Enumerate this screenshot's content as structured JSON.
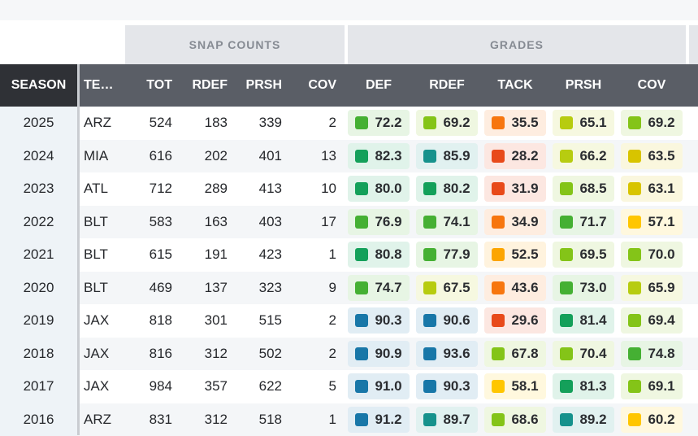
{
  "column_groups": {
    "snap_counts": "SNAP COUNTS",
    "grades": "GRADES"
  },
  "columns": {
    "season": "SEASON",
    "team": "TE…",
    "tot": "TOT",
    "rdef": "RDEF",
    "prsh": "PRSH",
    "cov": "COV",
    "g_def": "DEF",
    "g_rdef": "RDEF",
    "g_tack": "TACK",
    "g_prsh": "PRSH",
    "g_cov": "COV"
  },
  "grade_colors": {
    "elite": "#1877a8",
    "great": "#16928c",
    "high": "#14a05a",
    "good": "#45b033",
    "above_avg": "#84c418",
    "average": "#b7cc10",
    "below_avg": "#d8c400",
    "low": "#ffc600",
    "poor": "#fca500",
    "bad": "#f7760f",
    "very_bad": "#e84a1a"
  },
  "rows": [
    {
      "season": "2025",
      "team": "ARZ",
      "tot": "524",
      "rdef": "183",
      "prsh": "339",
      "cov": "2",
      "grades": [
        {
          "value": "72.2",
          "tier": "good"
        },
        {
          "value": "69.2",
          "tier": "above_avg"
        },
        {
          "value": "35.5",
          "tier": "bad"
        },
        {
          "value": "65.1",
          "tier": "average"
        },
        {
          "value": "69.2",
          "tier": "above_avg"
        }
      ]
    },
    {
      "season": "2024",
      "team": "MIA",
      "tot": "616",
      "rdef": "202",
      "prsh": "401",
      "cov": "13",
      "grades": [
        {
          "value": "82.3",
          "tier": "high"
        },
        {
          "value": "85.9",
          "tier": "great"
        },
        {
          "value": "28.2",
          "tier": "very_bad"
        },
        {
          "value": "66.2",
          "tier": "average"
        },
        {
          "value": "63.5",
          "tier": "below_avg"
        }
      ]
    },
    {
      "season": "2023",
      "team": "ATL",
      "tot": "712",
      "rdef": "289",
      "prsh": "413",
      "cov": "10",
      "grades": [
        {
          "value": "80.0",
          "tier": "high"
        },
        {
          "value": "80.2",
          "tier": "high"
        },
        {
          "value": "31.9",
          "tier": "very_bad"
        },
        {
          "value": "68.5",
          "tier": "above_avg"
        },
        {
          "value": "63.1",
          "tier": "below_avg"
        }
      ]
    },
    {
      "season": "2022",
      "team": "BLT",
      "tot": "583",
      "rdef": "163",
      "prsh": "403",
      "cov": "17",
      "grades": [
        {
          "value": "76.9",
          "tier": "good"
        },
        {
          "value": "74.1",
          "tier": "good"
        },
        {
          "value": "34.9",
          "tier": "bad"
        },
        {
          "value": "71.7",
          "tier": "good"
        },
        {
          "value": "57.1",
          "tier": "low"
        }
      ]
    },
    {
      "season": "2021",
      "team": "BLT",
      "tot": "615",
      "rdef": "191",
      "prsh": "423",
      "cov": "1",
      "grades": [
        {
          "value": "80.8",
          "tier": "high"
        },
        {
          "value": "77.9",
          "tier": "good"
        },
        {
          "value": "52.5",
          "tier": "poor"
        },
        {
          "value": "69.5",
          "tier": "above_avg"
        },
        {
          "value": "70.0",
          "tier": "above_avg"
        }
      ]
    },
    {
      "season": "2020",
      "team": "BLT",
      "tot": "469",
      "rdef": "137",
      "prsh": "323",
      "cov": "9",
      "grades": [
        {
          "value": "74.7",
          "tier": "good"
        },
        {
          "value": "67.5",
          "tier": "average"
        },
        {
          "value": "43.6",
          "tier": "bad"
        },
        {
          "value": "73.0",
          "tier": "good"
        },
        {
          "value": "65.9",
          "tier": "average"
        }
      ]
    },
    {
      "season": "2019",
      "team": "JAX",
      "tot": "818",
      "rdef": "301",
      "prsh": "515",
      "cov": "2",
      "grades": [
        {
          "value": "90.3",
          "tier": "elite"
        },
        {
          "value": "90.6",
          "tier": "elite"
        },
        {
          "value": "29.6",
          "tier": "very_bad"
        },
        {
          "value": "81.4",
          "tier": "high"
        },
        {
          "value": "69.4",
          "tier": "above_avg"
        }
      ]
    },
    {
      "season": "2018",
      "team": "JAX",
      "tot": "816",
      "rdef": "312",
      "prsh": "502",
      "cov": "2",
      "grades": [
        {
          "value": "90.9",
          "tier": "elite"
        },
        {
          "value": "93.6",
          "tier": "elite"
        },
        {
          "value": "67.8",
          "tier": "above_avg"
        },
        {
          "value": "70.4",
          "tier": "above_avg"
        },
        {
          "value": "74.8",
          "tier": "good"
        }
      ]
    },
    {
      "season": "2017",
      "team": "JAX",
      "tot": "984",
      "rdef": "357",
      "prsh": "622",
      "cov": "5",
      "grades": [
        {
          "value": "91.0",
          "tier": "elite"
        },
        {
          "value": "90.3",
          "tier": "elite"
        },
        {
          "value": "58.1",
          "tier": "low"
        },
        {
          "value": "81.3",
          "tier": "high"
        },
        {
          "value": "69.1",
          "tier": "above_avg"
        }
      ]
    },
    {
      "season": "2016",
      "team": "ARZ",
      "tot": "831",
      "rdef": "312",
      "prsh": "518",
      "cov": "1",
      "grades": [
        {
          "value": "91.2",
          "tier": "elite"
        },
        {
          "value": "89.7",
          "tier": "great"
        },
        {
          "value": "68.6",
          "tier": "above_avg"
        },
        {
          "value": "89.2",
          "tier": "great"
        },
        {
          "value": "60.2",
          "tier": "low"
        }
      ]
    }
  ]
}
